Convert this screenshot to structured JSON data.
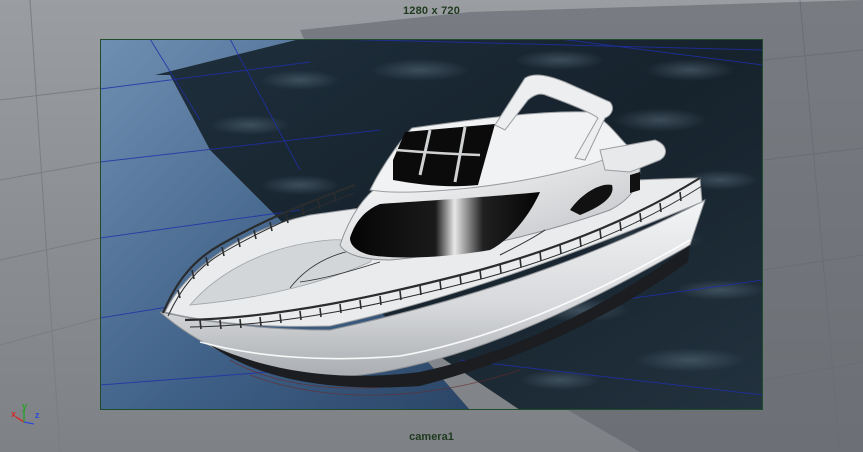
{
  "viewport": {
    "resolution_gate_label": "1280 x 720",
    "camera_name": "camera1"
  },
  "axis_indicator": {
    "x_label": "x",
    "y_label": "y",
    "z_label": "z",
    "x_color": "#d42a2a",
    "y_color": "#2aa02a",
    "z_color": "#2a4ad4"
  },
  "colors": {
    "background": "#8b8e92",
    "gate_border": "#1e4d2b",
    "water": "#1a2a36",
    "grid_line": "#1f2fa8",
    "boat_hull": "#e6e8ea",
    "railing": "#2a2c2e"
  }
}
